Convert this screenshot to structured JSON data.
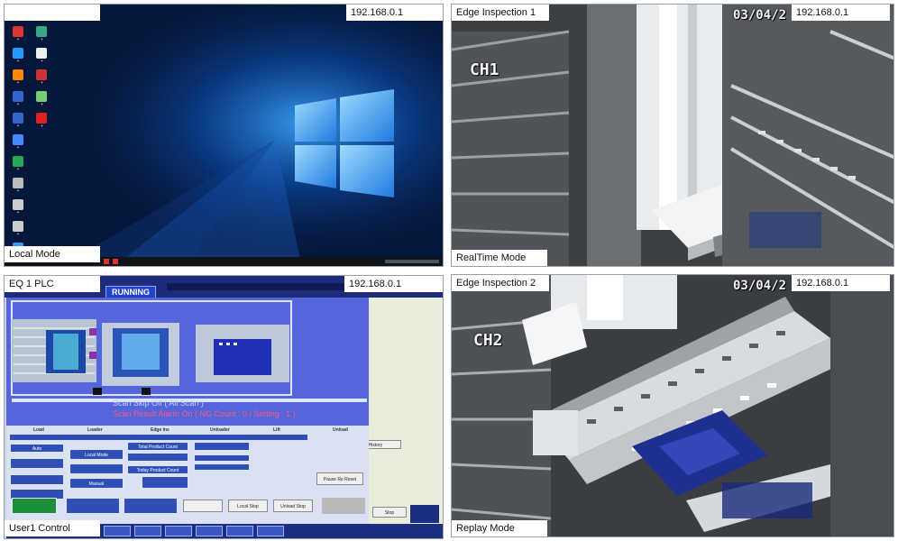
{
  "panes": {
    "local": {
      "label": "Local Mode",
      "ip": "192.168.0.1"
    },
    "edge1": {
      "title": "Edge Inspection 1",
      "ip": "192.168.0.1",
      "date": "03/04/2",
      "channel": "CH1",
      "mode": "RealTime Mode"
    },
    "plc": {
      "title": "EQ 1 PLC",
      "ip": "192.168.0.1",
      "mode": "User1 Control",
      "status": "RUNNING",
      "message1": "Scan Skip Off ( All Scan )",
      "message2": "Scan Result Alarm On ( NG Count : 0 / Setting : 1 )",
      "buttons": {
        "local_mode": "Local Mode",
        "manual": "Manual",
        "auto": "Auto",
        "total_product_count": "Total Product Count",
        "today_product_count": "Today Product Count",
        "pause_re_reset": "Pause Re Reset",
        "local_stop": "Local Stop",
        "unload_stop": "Unload Stop",
        "stop": "Stop",
        "ok_history": "OK History"
      },
      "headers": {
        "load": "Load",
        "loader": "Loader",
        "edge_ins": "Edge Ins",
        "unloader": "Unloader",
        "lift": "Lift",
        "unload": "Unload"
      }
    },
    "edge2": {
      "title": "Edge Inspection 2",
      "ip": "192.168.0.1",
      "date": "03/04/2",
      "channel": "CH2",
      "mode": "Replay Mode"
    }
  },
  "colors": {
    "desktop_bg": "#05173a",
    "windows_logo": "#4fb6ff",
    "plc_blue": "#5566dd",
    "running": "#2342c9"
  }
}
